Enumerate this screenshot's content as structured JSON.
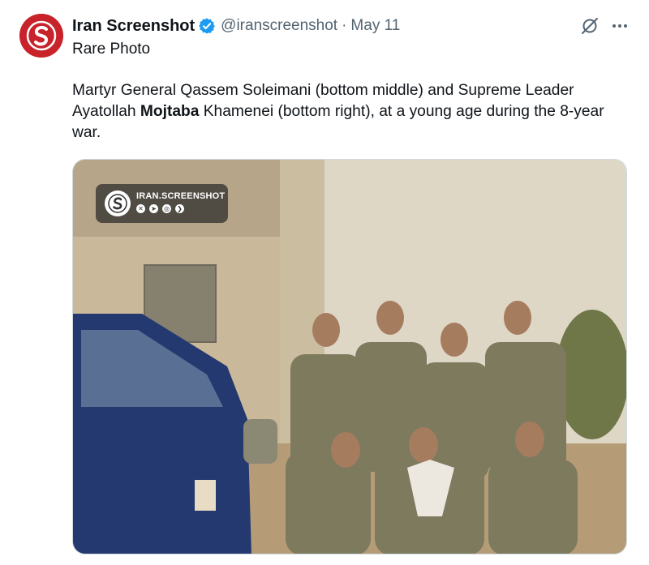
{
  "tweet": {
    "author_name": "Iran Screenshot",
    "handle": "@iranscreenshot",
    "separator": "·",
    "date": "May 11",
    "line1": "Rare Photo",
    "body_part1": "Martyr General Qassem Soleimani (bottom middle) and Supreme Leader Ayatollah ",
    "body_bold": "Mojtaba",
    "body_part2": " Khamenei (bottom right), at a young age during the 8-year war."
  },
  "watermark": {
    "name": "IRAN.SCREENSHOT",
    "icons": [
      "x-icon",
      "telegram-icon",
      "instagram-icon",
      "bale-icon"
    ]
  },
  "colors": {
    "brand_red": "#c8232b",
    "verified_blue": "#1d9bf0",
    "secondary_text": "#536471"
  }
}
